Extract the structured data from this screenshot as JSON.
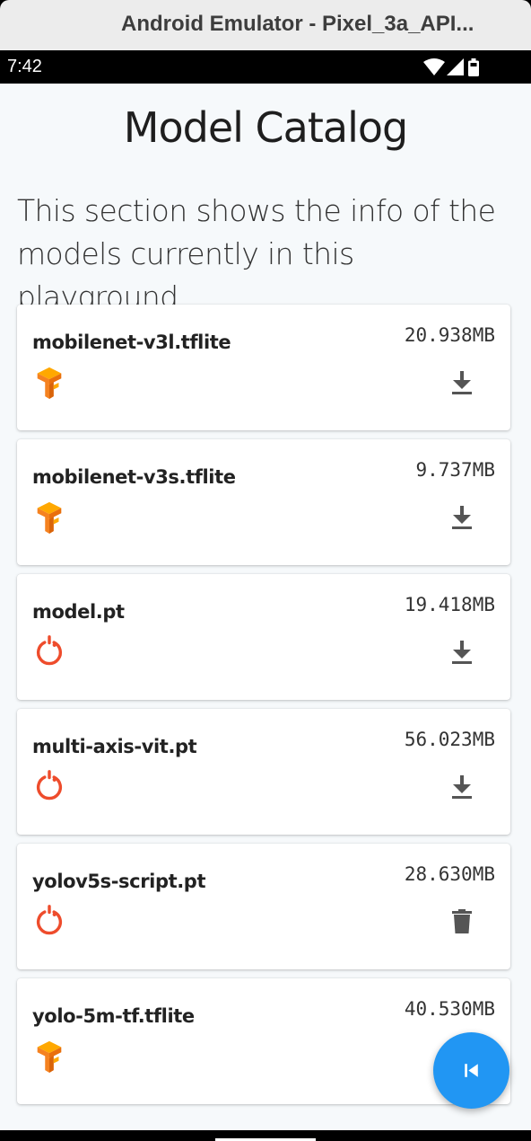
{
  "window": {
    "title": "Android Emulator - Pixel_3a_API..."
  },
  "status_bar": {
    "time": "7:42",
    "icons": [
      "wifi-icon",
      "signal-icon",
      "battery-icon"
    ]
  },
  "page": {
    "title": "Model Catalog",
    "description": "This section shows the info of the models currently in this playground"
  },
  "models": [
    {
      "name": "mobilenet-v3l.tflite",
      "size": "20.938MB",
      "framework": "tensorflow-lite",
      "action": "download"
    },
    {
      "name": "mobilenet-v3s.tflite",
      "size": "9.737MB",
      "framework": "tensorflow-lite",
      "action": "download"
    },
    {
      "name": "model.pt",
      "size": "19.418MB",
      "framework": "pytorch",
      "action": "download"
    },
    {
      "name": "multi-axis-vit.pt",
      "size": "56.023MB",
      "framework": "pytorch",
      "action": "download"
    },
    {
      "name": "yolov5s-script.pt",
      "size": "28.630MB",
      "framework": "pytorch",
      "action": "delete"
    },
    {
      "name": "yolo-5m-tf.tflite",
      "size": "40.530MB",
      "framework": "tensorflow-lite",
      "action": "download"
    }
  ],
  "fab": {
    "icon": "skip-previous-icon"
  },
  "colors": {
    "fab": "#2196f3",
    "tensorflow_orange": "#f58220",
    "tensorflow_yellow": "#ffa800",
    "pytorch_red": "#ee4c2c",
    "action_icon": "#555555"
  }
}
